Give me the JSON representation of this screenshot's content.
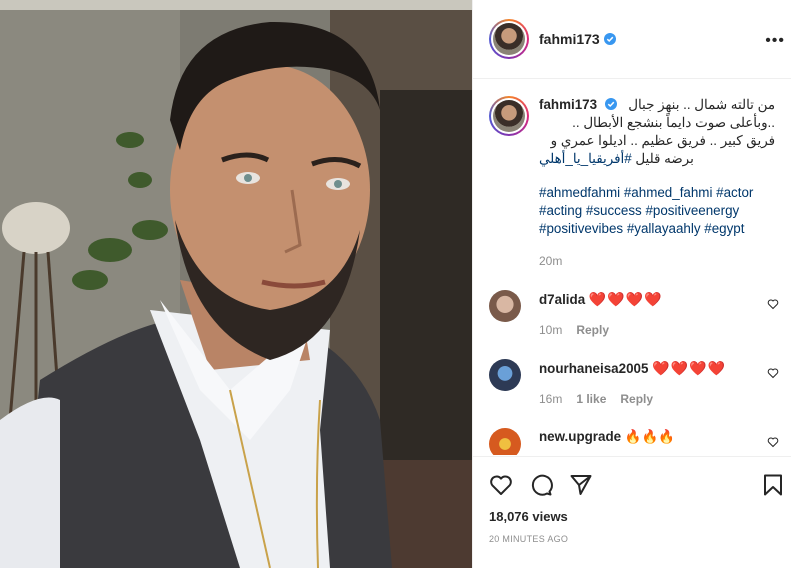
{
  "post": {
    "username": "fahmi173",
    "verified": true,
    "more_label": "•••"
  },
  "caption": {
    "username": "fahmi173",
    "first_line": "من تالته شمال .. بنهز جبال",
    "lines": [
      "..وبأعلى صوت دايماً بنشجع الأبطال ..",
      "فريق كبير .. فريق عظيم .. اديلوا عمري و",
      "برضه قليل"
    ],
    "arabic_hashtag": "#أفريقيا_يا_أهلي",
    "tags": [
      "#ahmedfahmi #ahmed_fahmi #actor",
      "#acting #success #positiveenergy",
      "#positivevibes #yallayaahly #egypt"
    ],
    "time": "20m"
  },
  "comments": [
    {
      "username": "d7alida",
      "text": "❤️❤️❤️❤️",
      "time": "10m",
      "likes": "",
      "reply": "Reply",
      "avatar_color": "#7a5a4a"
    },
    {
      "username": "nourhaneisa2005",
      "text": "❤️❤️❤️❤️",
      "time": "16m",
      "likes": "1 like",
      "reply": "Reply",
      "avatar_color": "#2d3a55"
    },
    {
      "username": "new.upgrade",
      "text": "🔥🔥🔥",
      "time": "",
      "likes": "",
      "reply": "",
      "avatar_color": "#d65a1f"
    }
  ],
  "footer": {
    "views": "18,076 views",
    "ago": "20 MINUTES AGO"
  },
  "colors": {
    "link": "#00376b",
    "muted": "#8e8e8e",
    "verified": "#3897f0"
  },
  "icons": [
    "like-icon",
    "comment-icon",
    "share-icon",
    "save-icon",
    "verified-badge-icon",
    "more-options-icon",
    "small-heart-icon"
  ]
}
